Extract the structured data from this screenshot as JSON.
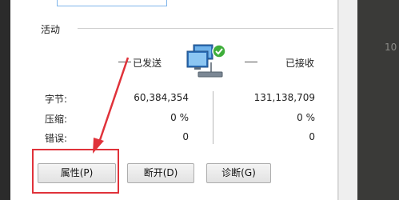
{
  "background": {
    "right_partial_text": "10"
  },
  "group": {
    "title": "活动"
  },
  "activity": {
    "sent_label": "已发送",
    "received_label": "已接收",
    "rows": [
      {
        "label": "字节:",
        "sent": "60,384,354",
        "received": "131,138,709"
      },
      {
        "label": "压缩:",
        "sent": "0 %",
        "received": "0 %"
      },
      {
        "label": "错误:",
        "sent": "0",
        "received": "0"
      }
    ]
  },
  "buttons": {
    "properties": "属性(P)",
    "disconnect": "断开(D)",
    "diagnose": "诊断(G)"
  },
  "icons": {
    "network": "network-computer-check-icon"
  },
  "colors": {
    "highlight": "#e0323a",
    "check": "#3fae3b"
  }
}
